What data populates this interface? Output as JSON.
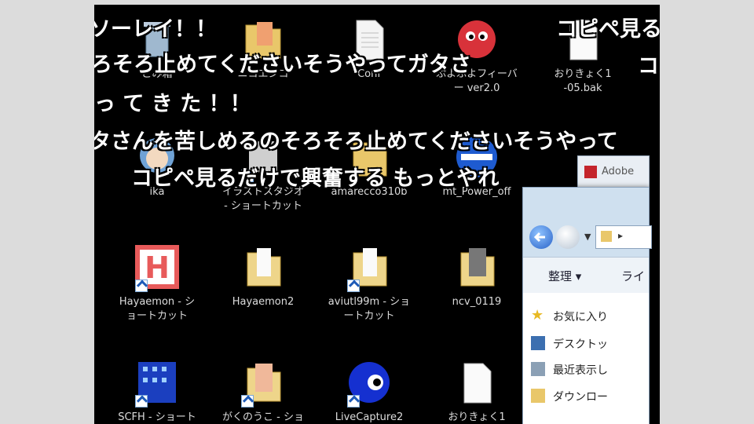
{
  "desktop": {
    "icons": [
      {
        "label": "ごみ箱"
      },
      {
        "label": "ニコエンコ"
      },
      {
        "label": "Conf"
      },
      {
        "label": "ぷよぷよフィーバ\nー ver2.0"
      },
      {
        "label": "おりきょく1\n-05.bak"
      },
      {
        "label": "ika"
      },
      {
        "label": "イラストスタジオ\n- ショートカット"
      },
      {
        "label": "amarecco310b"
      },
      {
        "label": "mt_Power_off"
      },
      {
        "label": "Hayaemon - シ\nョートカット"
      },
      {
        "label": "Hayaemon2"
      },
      {
        "label": "aviutl99m - ショ\nートカット"
      },
      {
        "label": "ncv_0119"
      },
      {
        "label": "SCFH - ショート"
      },
      {
        "label": "がくのうこ - ショ"
      },
      {
        "label": "LiveCapture2"
      },
      {
        "label": "おりきょく1"
      }
    ]
  },
  "window": {
    "tab_label": "Adobe",
    "toolbar_label": "整理 ▾",
    "toolbar_label2": "ライ",
    "nav_items": [
      "お気に入り",
      "デスクトッ",
      "最近表示し",
      "ダウンロー"
    ]
  },
  "comments": [
    "ソーレイ！！",
    "コピペ見る",
    "ろそろ止めてくださいそうやってガタさ",
    "コ",
    "っ て き た ！！",
    "タさんを苦しめるのそろそろ止めてくださいそうやって",
    "コピペ見るだけで興奮する もっとやれ"
  ],
  "colors": {
    "pillar": "#dcdcdc",
    "desktop": "#000000",
    "window_frame": "#cfe0ef"
  }
}
